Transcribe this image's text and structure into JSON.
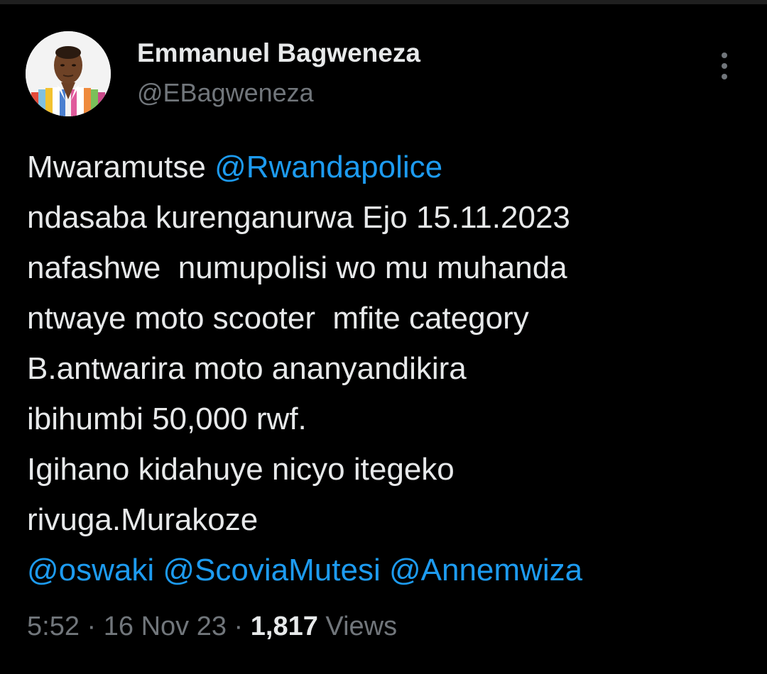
{
  "author": {
    "display_name": "Emmanuel Bagweneza",
    "handle": "@EBagweneza"
  },
  "tweet": {
    "line1_prefix": "Mwaramutse ",
    "mention_rwandapolice": "@Rwandapolice",
    "line2": "ndasaba kurenganurwa Ejo 15.11.2023",
    "line3": "nafashwe  numupolisi wo mu muhanda",
    "line4": "ntwaye moto scooter  mfite category",
    "line5": "B.antwarira moto ananyandikira",
    "line6": "ibihumbi 50,000 rwf.",
    "line7": "Igihano kidahuye nicyo itegeko",
    "line8": "rivuga.Murakoze",
    "mention_oswaki": "@oswaki",
    "mention_scovia": "@ScoviaMutesi",
    "mention_anne": "@Annemwiza",
    "space": " "
  },
  "meta": {
    "time": "5:52",
    "sep": " · ",
    "date": "16 Nov 23",
    "views_count": "1,817",
    "views_label": " Views"
  },
  "icons": {
    "more": "more-vertical-icon"
  },
  "colors": {
    "background": "#000000",
    "text": "#e7e9ea",
    "secondary": "#71767b",
    "accent": "#1d9bf0"
  }
}
